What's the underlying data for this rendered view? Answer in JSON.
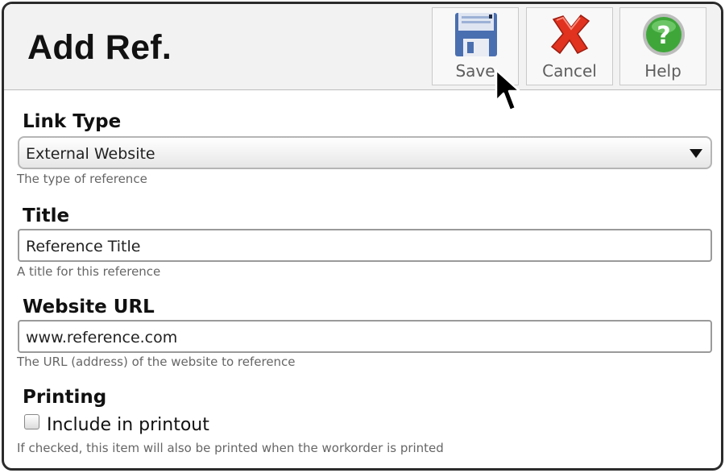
{
  "header": {
    "title": "Add Ref."
  },
  "toolbar": {
    "save_label": "Save",
    "cancel_label": "Cancel",
    "help_label": "Help",
    "save_icon": "floppy-disk-icon",
    "cancel_icon": "red-x-icon",
    "help_icon": "green-question-icon"
  },
  "form": {
    "link_type": {
      "label": "Link Type",
      "value": "External Website",
      "hint": "The type of reference"
    },
    "title": {
      "label": "Title",
      "value": "Reference Title",
      "hint": "A title for this reference"
    },
    "url": {
      "label": "Website URL",
      "value": "www.reference.com",
      "hint": "The URL (address) of the website to reference"
    },
    "printing": {
      "label": "Printing",
      "checkbox_label": "Include in printout",
      "checked": false,
      "hint": "If checked, this item will also be printed when the workorder is printed"
    }
  },
  "colors": {
    "save_blue": "#4a6fb0",
    "cancel_red": "#e0321e",
    "help_green": "#3fa73a"
  }
}
